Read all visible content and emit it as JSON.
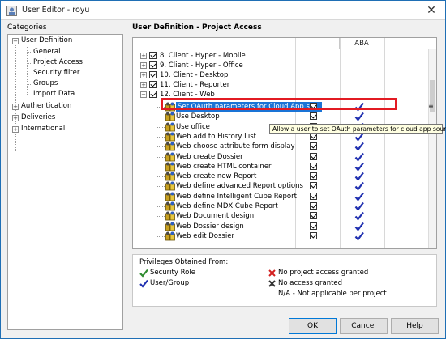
{
  "window": {
    "title": "User Editor - royu"
  },
  "sidebar": {
    "header": "Categories",
    "items": [
      {
        "label": "User Definition",
        "expanded": true,
        "toggle": "−"
      },
      {
        "label": "General"
      },
      {
        "label": "Project Access"
      },
      {
        "label": "Security filter"
      },
      {
        "label": "Groups"
      },
      {
        "label": "Import Data"
      },
      {
        "label": "Authentication",
        "toggle": "+"
      },
      {
        "label": "Deliveries",
        "toggle": "+"
      },
      {
        "label": "International",
        "toggle": "+"
      }
    ]
  },
  "main": {
    "title": "User Definition - Project Access",
    "column_header": "ABA",
    "groups": [
      {
        "label": "8. Client - Hyper - Mobile",
        "toggle": "+"
      },
      {
        "label": "9. Client - Hyper - Office",
        "toggle": "+"
      },
      {
        "label": "10. Client - Desktop",
        "toggle": "+"
      },
      {
        "label": "11. Client - Reporter",
        "toggle": "+"
      },
      {
        "label": "12. Client - Web",
        "toggle": "−"
      }
    ],
    "privileges": [
      {
        "label": "Set OAuth parameters for Cloud App so...",
        "selected": true
      },
      {
        "label": "Use Desktop"
      },
      {
        "label": "Use office"
      },
      {
        "label": "Web add to History List"
      },
      {
        "label": "Web choose attribute form display"
      },
      {
        "label": "Web create Dossier"
      },
      {
        "label": "Web create HTML container"
      },
      {
        "label": "Web create new Report"
      },
      {
        "label": "Web define advanced Report options"
      },
      {
        "label": "Web define Intelligent Cube Report"
      },
      {
        "label": "Web define MDX Cube Report"
      },
      {
        "label": "Web Document design"
      },
      {
        "label": "Web Dossier design"
      },
      {
        "label": "Web edit Dossier"
      }
    ],
    "tooltip": "Allow a user to set OAuth parameters for cloud app sources",
    "grip": "≡"
  },
  "legend": {
    "title": "Privileges Obtained From:",
    "security_role": "Security Role",
    "user_group": "User/Group",
    "no_project_access": "No project access granted",
    "no_access": "No access granted",
    "na": "N/A - Not applicable per project"
  },
  "buttons": {
    "ok": "OK",
    "cancel": "Cancel",
    "help": "Help"
  },
  "colors": {
    "accent_blue": "#1a74d6",
    "highlight_red": "#e21b23",
    "tick_blue": "#1f2fb0",
    "tick_green": "#2e8b2e",
    "cross_red": "#d42020"
  }
}
